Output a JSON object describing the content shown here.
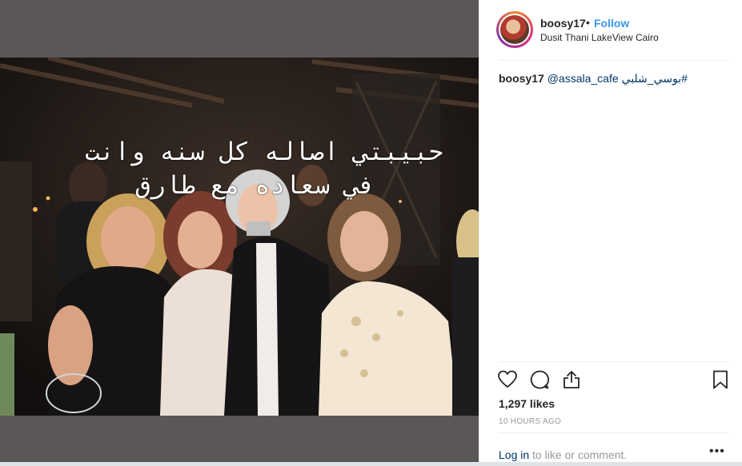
{
  "post": {
    "overlay_line_1": "حبيبتي اصاله كل سنه وانت",
    "overlay_line_2": "في سعاده مع طارق"
  },
  "header": {
    "username": "boosy17",
    "separator": "•",
    "follow_label": "Follow",
    "location": "Dusit Thani LakeView Cairo"
  },
  "caption": {
    "username": "boosy17",
    "mention": "@assala_cafe",
    "hashtag": "#بوسي_شلبي"
  },
  "actions": {
    "like_icon": "heart-icon",
    "comment_icon": "comment-icon",
    "share_icon": "share-icon",
    "save_icon": "bookmark-icon"
  },
  "stats": {
    "likes": "1,297 likes",
    "time_ago": "10 HOURS AGO"
  },
  "footer": {
    "login_link": "Log in",
    "login_rest": " to like or comment.",
    "more": "•••"
  },
  "colors": {
    "accent": "#3897f0",
    "link": "#003569",
    "muted": "#999999",
    "text": "#262626"
  }
}
